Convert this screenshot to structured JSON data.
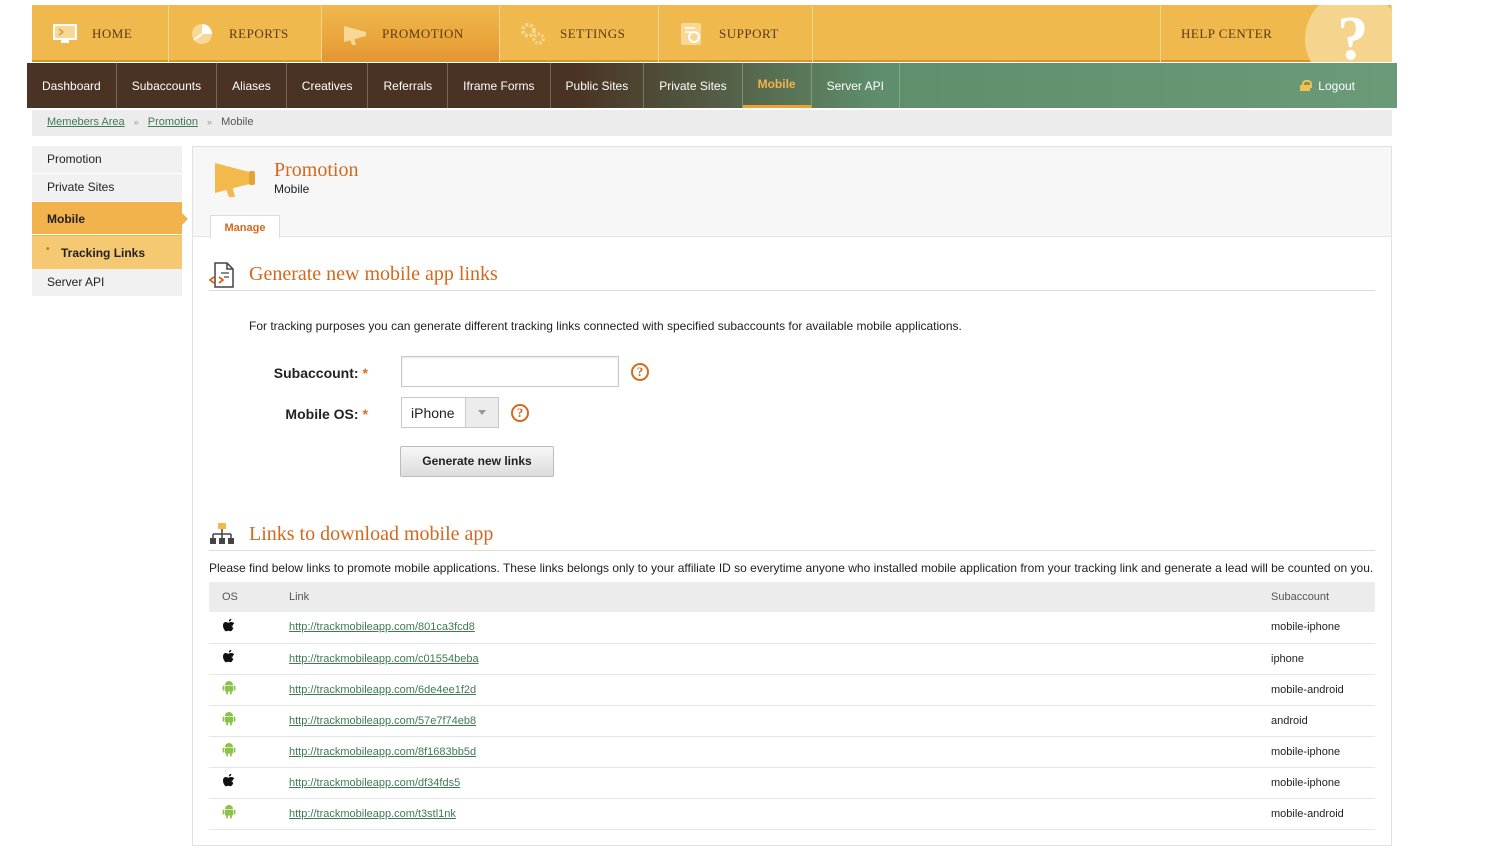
{
  "topnav": {
    "items": [
      {
        "label": "HOME",
        "icon": "monitor-icon"
      },
      {
        "label": "REPORTS",
        "icon": "pie-chart-icon"
      },
      {
        "label": "PROMOTION",
        "icon": "megaphone-icon"
      },
      {
        "label": "SETTINGS",
        "icon": "gears-icon"
      },
      {
        "label": "SUPPORT",
        "icon": "support-icon"
      }
    ],
    "help_center": "HELP CENTER",
    "help_glyph": "?"
  },
  "subnav": {
    "items": [
      "Dashboard",
      "Subaccounts",
      "Aliases",
      "Creatives",
      "Referrals",
      "Iframe Forms",
      "Public Sites",
      "Private Sites",
      "Mobile",
      "Server API"
    ],
    "logout": "Logout"
  },
  "breadcrumb": {
    "items": [
      "Memebers Area",
      "Promotion"
    ],
    "current": "Mobile",
    "separator": "»"
  },
  "sidebar": {
    "items": [
      "Promotion",
      "Private Sites",
      "Mobile",
      "Server API"
    ],
    "sub_item": "Tracking Links"
  },
  "header": {
    "title": "Promotion",
    "subtitle": "Mobile",
    "tab": "Manage"
  },
  "generate": {
    "heading": "Generate new mobile app links",
    "description": "For tracking purposes you can generate different tracking links connected with specified subaccounts for available mobile applications.",
    "subaccount_label": "Subaccount:",
    "subaccount_value": "",
    "os_label": "Mobile OS:",
    "os_value": "iPhone",
    "required_mark": "*",
    "help_glyph": "?",
    "button": "Generate new links"
  },
  "links": {
    "heading": "Links to download mobile app",
    "description": "Please find below links to promote mobile applications. These links belongs only to your affiliate ID so everytime anyone who installed mobile application from your tracking link and generate a lead will be counted on you.",
    "columns": [
      "OS",
      "Link",
      "Subaccount"
    ],
    "rows": [
      {
        "os": "apple",
        "link": "http://trackmobileapp.com/801ca3fcd8",
        "subaccount": "mobile-iphone"
      },
      {
        "os": "apple",
        "link": "http://trackmobileapp.com/c01554beba",
        "subaccount": "iphone"
      },
      {
        "os": "android",
        "link": "http://trackmobileapp.com/6de4ee1f2d",
        "subaccount": "mobile-android"
      },
      {
        "os": "android",
        "link": "http://trackmobileapp.com/57e7f74eb8",
        "subaccount": "android"
      },
      {
        "os": "android",
        "link": "http://trackmobileapp.com/8f1683bb5d",
        "subaccount": "mobile-iphone"
      },
      {
        "os": "apple",
        "link": "http://trackmobileapp.com/df34fds5",
        "subaccount": "mobile-iphone"
      },
      {
        "os": "android",
        "link": "http://trackmobileapp.com/t3stl1nk",
        "subaccount": "mobile-android"
      }
    ]
  },
  "colors": {
    "accent": "#d2691e",
    "topnav": "#efb94d",
    "link": "#3f7a55",
    "android": "#8bc34a"
  }
}
